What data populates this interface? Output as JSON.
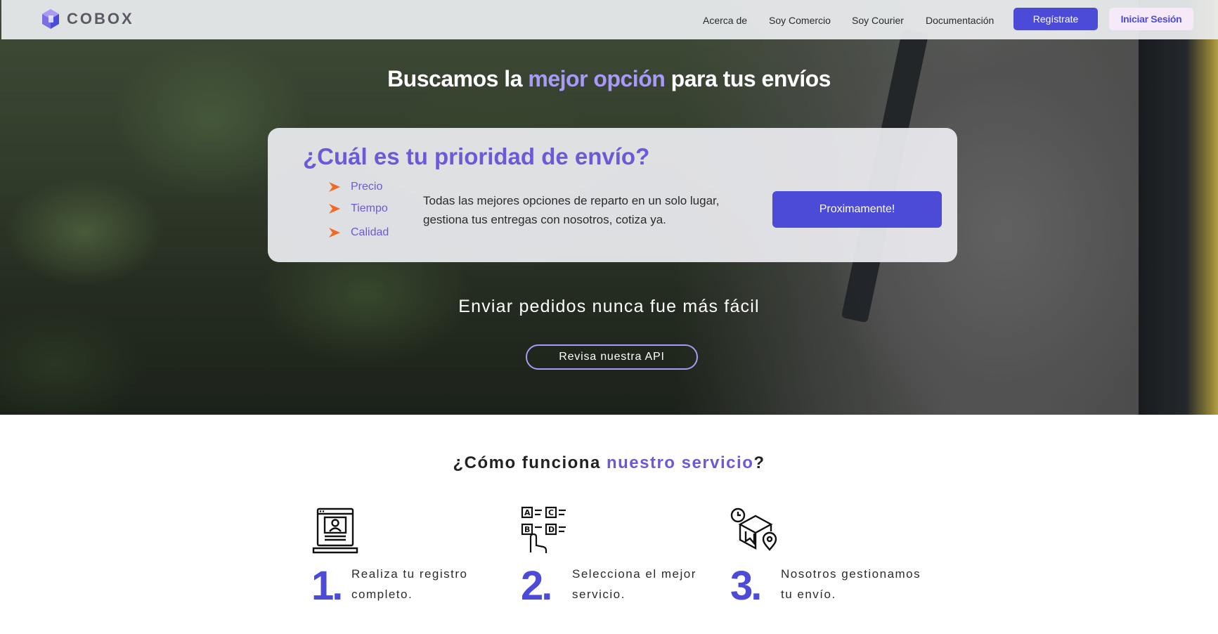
{
  "brand": {
    "name": "COBOX"
  },
  "nav": {
    "links": [
      "Acerca de",
      "Soy Comercio",
      "Soy Courier",
      "Documentación"
    ],
    "register_label": "Regístrate",
    "login_label": "Iniciar Sesión"
  },
  "hero": {
    "title_pre": "Buscamos la ",
    "title_accent": "mejor opción",
    "title_post": " para tus envíos",
    "card": {
      "title": "¿Cuál es tu prioridad de envío?",
      "priorities": [
        "Precio",
        "Tiempo",
        "Calidad"
      ],
      "description": "Todas las mejores opciones de reparto en un solo lugar, gestiona tus entregas con nosotros, cotiza ya.",
      "button_label": "Proximamente!"
    },
    "subtitle": "Enviar pedidos nunca fue más fácil",
    "api_button_label": "Revisa nuestra API"
  },
  "how": {
    "title_pre": "¿Cómo funciona ",
    "title_accent": "nuestro servicio",
    "title_post": "?",
    "steps": [
      {
        "number": "1.",
        "text": "Realiza tu registro completo.",
        "icon": "laptop-profile-icon"
      },
      {
        "number": "2.",
        "text": "Selecciona el mejor servicio.",
        "icon": "select-options-icon"
      },
      {
        "number": "3.",
        "text": "Nosotros gestionamos tu envío.",
        "icon": "delivery-box-icon"
      }
    ]
  },
  "colors": {
    "primary": "#4b4bd8",
    "accent": "#6b5ad8",
    "accent_light": "#a99af5",
    "arrow": "#f26a21"
  }
}
